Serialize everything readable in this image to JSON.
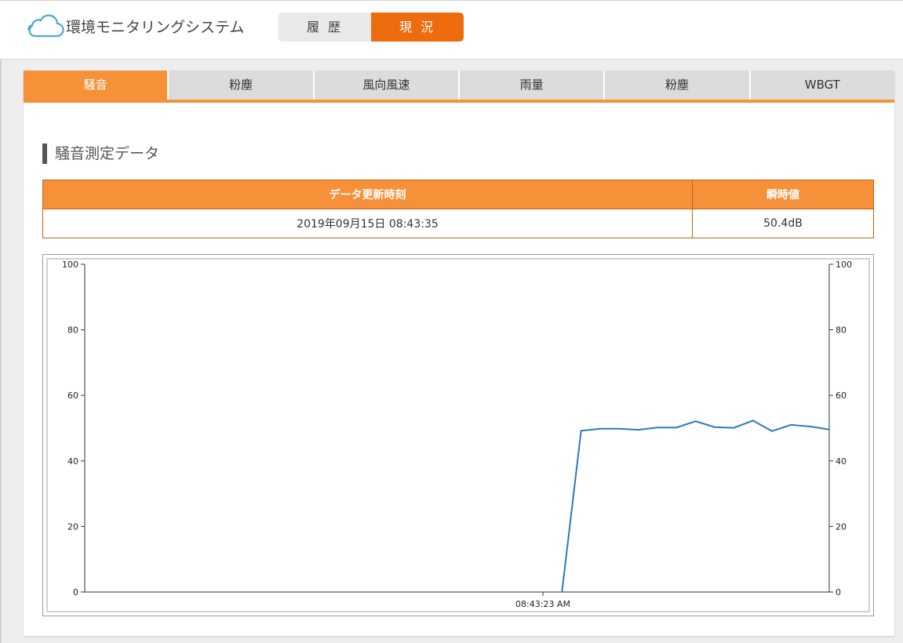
{
  "header": {
    "app_title": "環境モニタリングシステム",
    "logo_icon": "cloud-icon",
    "modes": [
      {
        "label": "履 歴",
        "active": false
      },
      {
        "label": "現 況",
        "active": true
      }
    ]
  },
  "tabs": [
    {
      "label": "騒音",
      "active": true
    },
    {
      "label": "粉塵",
      "active": false
    },
    {
      "label": "風向風速",
      "active": false
    },
    {
      "label": "雨量",
      "active": false
    },
    {
      "label": "粉塵",
      "active": false
    },
    {
      "label": "WBGT",
      "active": false
    }
  ],
  "section": {
    "title": "騒音測定データ"
  },
  "table": {
    "headers": [
      "データ更新時刻",
      "瞬時値"
    ],
    "row": [
      "2019年09月15日 08:43:35",
      "50.4dB"
    ]
  },
  "colors": {
    "accent": "#f6913a",
    "mode_active": "#ed6c0e",
    "line": "#2c7bb6",
    "logo": "#4aa8d8"
  },
  "chart_data": {
    "type": "line",
    "x_tick_labels": [
      "08:43:23 AM"
    ],
    "ylim": [
      0,
      100
    ],
    "y_ticks": [
      0,
      20,
      40,
      60,
      80,
      100
    ],
    "secondary_y_ticks": [
      0,
      20,
      40,
      60,
      80,
      100
    ],
    "grid": false,
    "series": [
      {
        "x": [
          0,
          1,
          2,
          3,
          4,
          5,
          6,
          7,
          8,
          9,
          10,
          11,
          12,
          13,
          14,
          15,
          16,
          17,
          18,
          19,
          20,
          21,
          22,
          23,
          24,
          25,
          26,
          27,
          28,
          29,
          30,
          31,
          32,
          33,
          34,
          35,
          36,
          37,
          38,
          39
        ],
        "values": [
          null,
          null,
          null,
          null,
          null,
          null,
          null,
          null,
          null,
          null,
          null,
          null,
          null,
          null,
          null,
          null,
          null,
          null,
          null,
          null,
          null,
          null,
          null,
          null,
          null,
          0,
          49.2,
          49.8,
          49.8,
          49.5,
          50.2,
          50.2,
          52.1,
          50.3,
          50.1,
          52.3,
          49.1,
          51.0,
          50.5,
          49.6
        ]
      }
    ]
  }
}
